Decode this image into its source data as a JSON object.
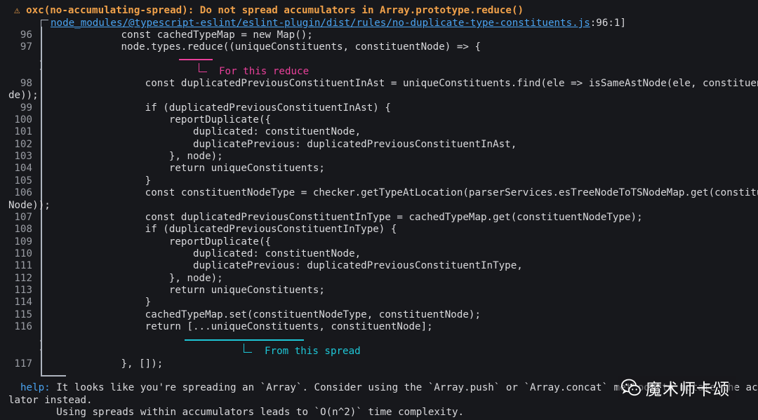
{
  "header": {
    "warning_icon": "warning-icon",
    "title": "⚠ oxc(no-accumulating-spread): Do not spread accumulators in Array.prototype.reduce()",
    "location_path": "node_modules/@typescript-eslint/eslint-plugin/dist/rules/no-duplicate-type-constituents.js",
    "location_pos": ":96:1]"
  },
  "code_lines": [
    {
      "num": "96",
      "text": "            const cachedTypeMap = new Map();"
    },
    {
      "num": "97",
      "text": "            node.types.reduce((uniqueConstituents, constituentNode) => {"
    },
    {
      "num": "98",
      "text": "                const duplicatedPreviousConstituentInAst = uniqueConstituents.find(ele => isSameAstNode(ele, constituentNo"
    },
    {
      "num": "",
      "text": "de));"
    },
    {
      "num": "99",
      "text": "                if (duplicatedPreviousConstituentInAst) {"
    },
    {
      "num": "100",
      "text": "                    reportDuplicate({"
    },
    {
      "num": "101",
      "text": "                        duplicated: constituentNode,"
    },
    {
      "num": "102",
      "text": "                        duplicatePrevious: duplicatedPreviousConstituentInAst,"
    },
    {
      "num": "103",
      "text": "                    }, node);"
    },
    {
      "num": "104",
      "text": "                    return uniqueConstituents;"
    },
    {
      "num": "105",
      "text": "                }"
    },
    {
      "num": "106",
      "text": "                const constituentNodeType = checker.getTypeAtLocation(parserServices.esTreeNodeToTSNodeMap.get(constituent"
    },
    {
      "num": "",
      "text": "Node));"
    },
    {
      "num": "107",
      "text": "                const duplicatedPreviousConstituentInType = cachedTypeMap.get(constituentNodeType);"
    },
    {
      "num": "108",
      "text": "                if (duplicatedPreviousConstituentInType) {"
    },
    {
      "num": "109",
      "text": "                    reportDuplicate({"
    },
    {
      "num": "110",
      "text": "                        duplicated: constituentNode,"
    },
    {
      "num": "111",
      "text": "                        duplicatePrevious: duplicatedPreviousConstituentInType,"
    },
    {
      "num": "112",
      "text": "                    }, node);"
    },
    {
      "num": "113",
      "text": "                    return uniqueConstituents;"
    },
    {
      "num": "114",
      "text": "                }"
    },
    {
      "num": "115",
      "text": "                cachedTypeMap.set(constituentNodeType, constituentNode);"
    },
    {
      "num": "116",
      "text": "                return [...uniqueConstituents, constituentNode];"
    },
    {
      "num": "117",
      "text": "            }, []);"
    }
  ],
  "annotations": {
    "reduce_label": "For this reduce",
    "spread_label": "From this spread"
  },
  "help": {
    "label": "help:",
    "line1": " It looks like you're spreading an `Array`. Consider using the `Array.push` or `Array.concat` methods to mutate the accumu",
    "line2": "lator instead.",
    "line3": "      Using spreads within accumulators leads to `O(n^2)` time complexity."
  },
  "watermark": {
    "text": "魔术师卡颂",
    "icon": "wechat-icon"
  },
  "colors": {
    "background": "#17181c",
    "warning": "#f0a14a",
    "path_link": "#4aa3f0",
    "reduce_annotation": "#e9409a",
    "spread_annotation": "#1ec6d6"
  }
}
